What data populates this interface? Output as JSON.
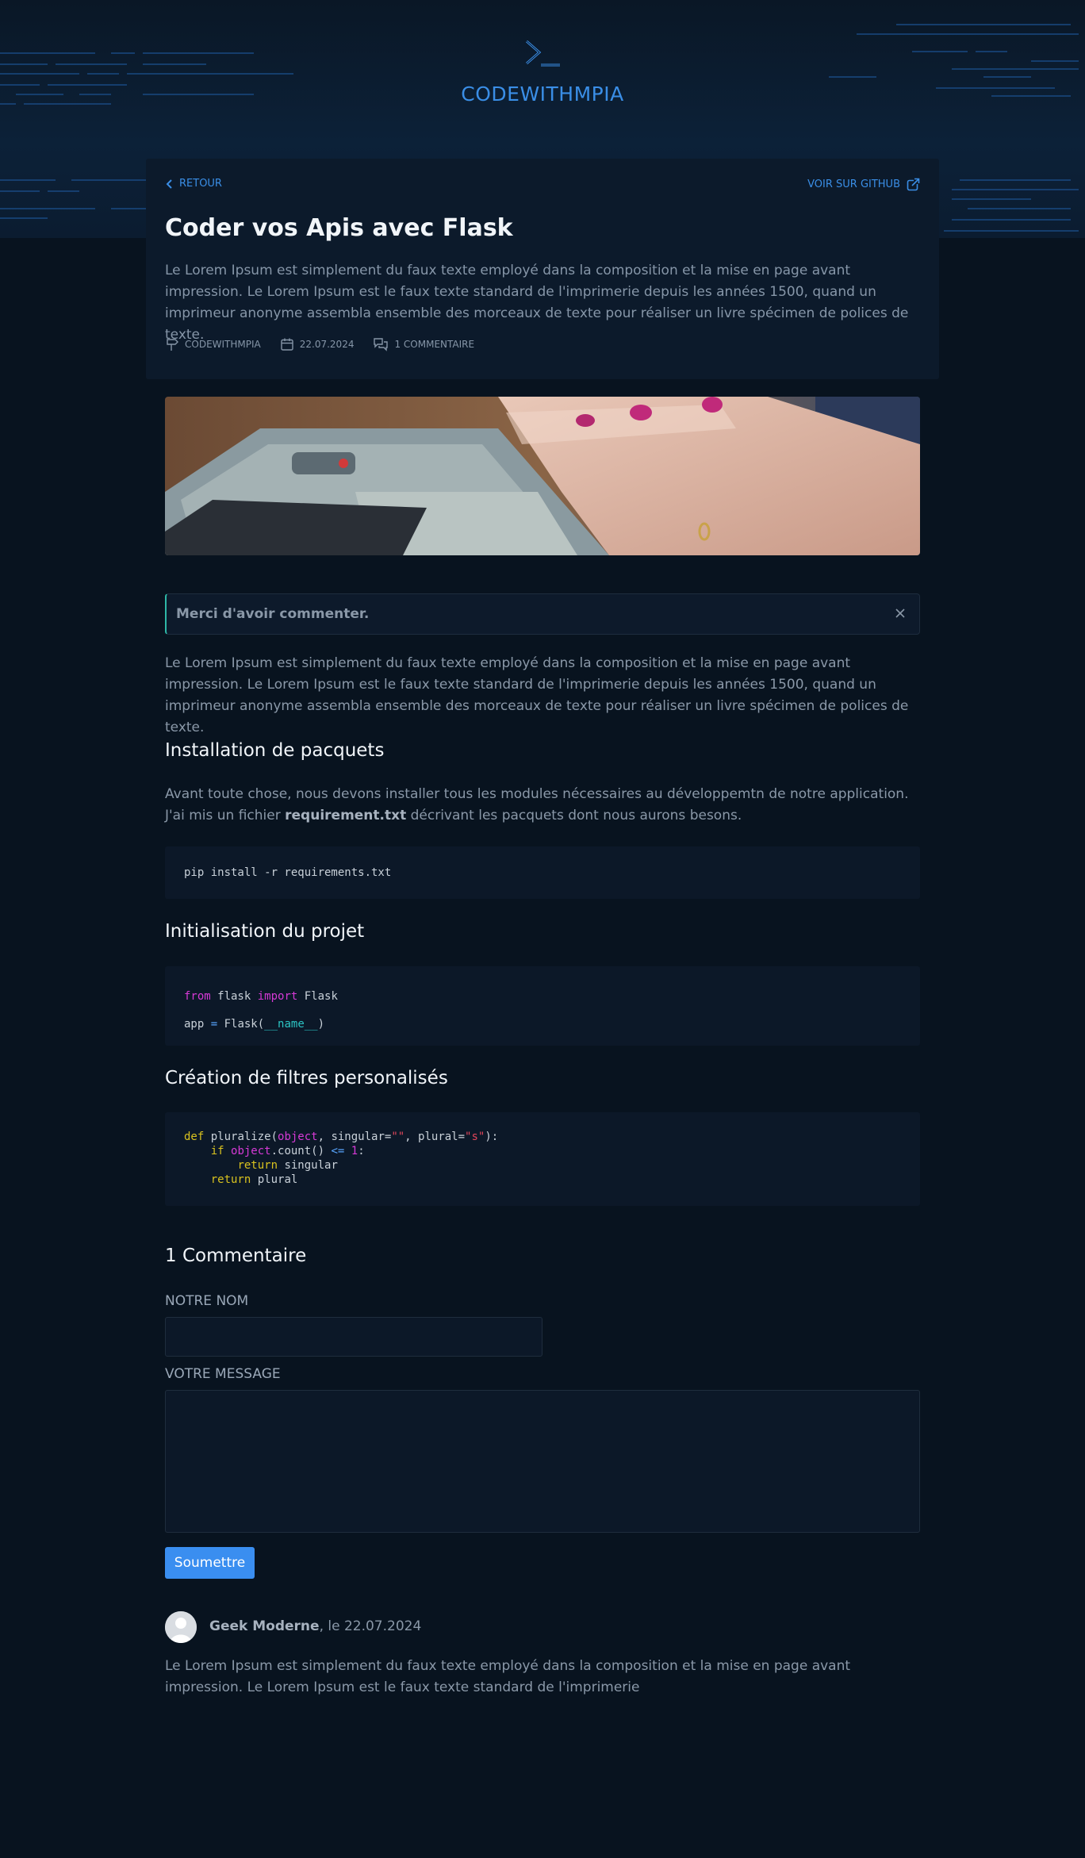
{
  "brand": {
    "name": "CODEWITHMPIA",
    "logo_icon": "terminal-prompt-icon",
    "accent": "#3a8ee6"
  },
  "nav": {
    "back_label": "RETOUR",
    "github_label": "VOIR SUR GITHUB"
  },
  "article": {
    "title": "Coder vos Apis avec Flask",
    "lead": "Le Lorem Ipsum est simplement du faux texte employé dans la composition et la mise en page avant impression. Le Lorem Ipsum est le faux texte standard de l'imprimerie depuis les années 1500, quand un imprimeur anonyme assembla ensemble des morceaux de texte pour réaliser un livre spécimen de polices de texte.",
    "meta": {
      "author": "CODEWITHMPIA",
      "date": "22.07.2024",
      "comments": "1 COMMENTAIRE"
    }
  },
  "alert": {
    "message": "Merci d'avoir commenter.",
    "color": "#2eb8a7"
  },
  "body": {
    "intro": "Le Lorem Ipsum est simplement du faux texte employé dans la composition et la mise en page avant impression. Le Lorem Ipsum est le faux texte standard de l'imprimerie depuis les années 1500, quand un imprimeur anonyme assembla ensemble des morceaux de texte pour réaliser un livre spécimen de polices de texte.",
    "section1": {
      "title": "Installation de pacquets",
      "text_before": "Avant toute chose, nous devons installer tous les modules nécessaires au développemtn de notre application. J'ai mis un fichier ",
      "text_bold": "requirement.txt",
      "text_after": " décrivant les pacquets dont nous aurons besons.",
      "code": "pip install -r requirements.txt"
    },
    "section2": {
      "title": "Initialisation du projet",
      "code": {
        "l1_kw1": "from",
        "l1_mod": " flask ",
        "l1_kw2": "import",
        "l1_name": " Flask",
        "l2_pre": "app ",
        "l2_eq": "=",
        "l2_call": " Flask(",
        "l2_arg": "__name__",
        "l2_close": ")"
      }
    },
    "section3": {
      "title": "Création de filtres personalisés",
      "code": {
        "def": "def",
        "fn": " pluralize(",
        "obj": "object",
        "sing": ", singular=",
        "str1": "\"\"",
        "plur": ", plural=",
        "str2": "\"s\"",
        "end1": "):",
        "if": "if",
        "obj2": "object",
        "count": ".count() ",
        "le": "<=",
        "one": "1",
        "colon": ":",
        "ret1": "return",
        "sing2": " singular",
        "ret2": "return",
        "plur2": " plural"
      }
    }
  },
  "comments": {
    "heading": "1 Commentaire",
    "name_label": "NOTRE NOM",
    "name_value": "",
    "message_label": "VOTRE MESSAGE",
    "message_value": "",
    "submit_label": "Soumettre",
    "list": [
      {
        "author": "Geek Moderne",
        "date_suffix": ", le 22.07.2024",
        "text": "Le Lorem Ipsum est simplement du faux texte employé dans la composition et la mise en page avant impression. Le Lorem Ipsum est le faux texte standard de l'imprimerie"
      }
    ]
  }
}
